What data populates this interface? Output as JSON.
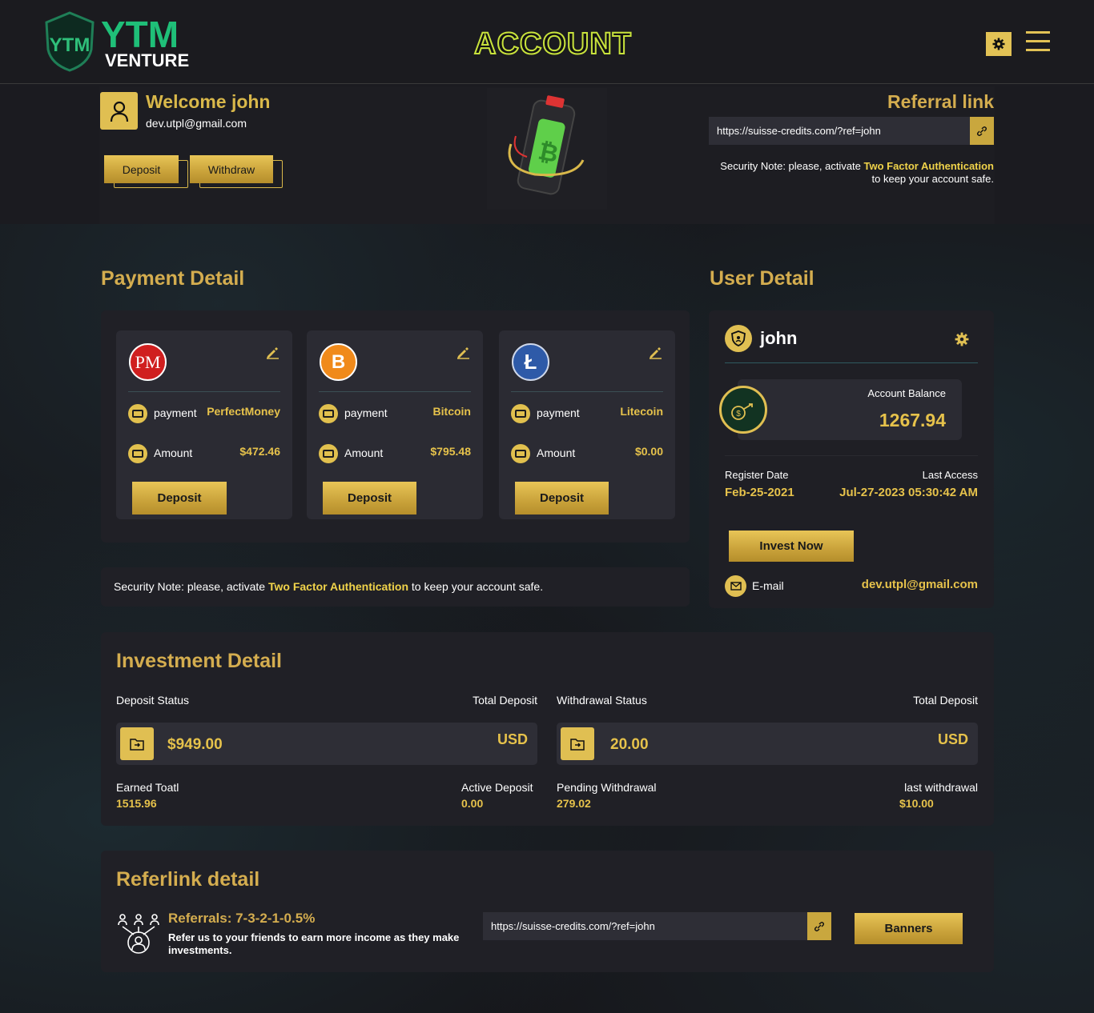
{
  "header": {
    "logo_main": "YTM",
    "logo_sub": "VENTURE",
    "page_title": "ACCOUNT"
  },
  "welcome": {
    "greeting": "Welcome john",
    "email": "dev.utpl@gmail.com",
    "deposit_label": "Deposit",
    "withdraw_label": "Withdraw"
  },
  "referral": {
    "title": "Referral link",
    "link": "https://suisse-credits.com/?ref=john",
    "note_prefix": "Security Note: please, activate ",
    "note_link": "Two Factor Authentication",
    "note_suffix": "to keep your account safe."
  },
  "payment_detail": {
    "title": "Payment Detail",
    "cards": [
      {
        "logo": "PM",
        "payment_label": "payment",
        "payment_value": "PerfectMoney",
        "amount_label": "Amount",
        "amount_value": "$472.46",
        "button": "Deposit"
      },
      {
        "logo": "B",
        "payment_label": "payment",
        "payment_value": "Bitcoin",
        "amount_label": "Amount",
        "amount_value": "$795.48",
        "button": "Deposit"
      },
      {
        "logo": "Ł",
        "payment_label": "payment",
        "payment_value": "Litecoin",
        "amount_label": "Amount",
        "amount_value": "$0.00",
        "button": "Deposit"
      }
    ],
    "note_prefix": "Security Note: please, activate ",
    "note_link": "Two Factor Authentication",
    "note_suffix": " to keep your account safe."
  },
  "user_detail": {
    "title": "User Detail",
    "username": "john",
    "balance_label": "Account Balance",
    "balance_value": "1267.94",
    "register_label": "Register Date",
    "register_value": "Feb-25-2021",
    "access_label": "Last Access",
    "access_value": "Jul-27-2023 05:30:42 AM",
    "invest_button": "Invest Now",
    "email_label": "E-mail",
    "email_value": "dev.utpl@gmail.com"
  },
  "investment": {
    "title": "Investment Detail",
    "deposit_status_label": "Deposit Status",
    "total_deposit_label_1": "Total Deposit",
    "deposit_value": "$949.00",
    "currency_1": "USD",
    "withdrawal_status_label": "Withdrawal Status",
    "total_deposit_label_2": "Total Deposit",
    "withdrawal_value": "20.00",
    "currency_2": "USD",
    "earned_label": "Earned Toatl",
    "earned_value": "1515.96",
    "active_label": "Active Deposit",
    "active_value": "0.00",
    "pending_label": "Pending Withdrawal",
    "pending_value": "279.02",
    "last_withdrawal_label": "last withdrawal",
    "last_withdrawal_value": "$10.00"
  },
  "referlink": {
    "title": "Referlink detail",
    "referrals_title": "Referrals: 7-3-2-1-0.5%",
    "referrals_desc": "Refer us to your friends to earn more income as they make investments.",
    "link": "https://suisse-credits.com/?ref=john",
    "banners_button": "Banners"
  },
  "colors": {
    "accent": "#d4ad4f",
    "background": "#1b1b20",
    "panel": "#202026",
    "card": "#2b2b33"
  }
}
